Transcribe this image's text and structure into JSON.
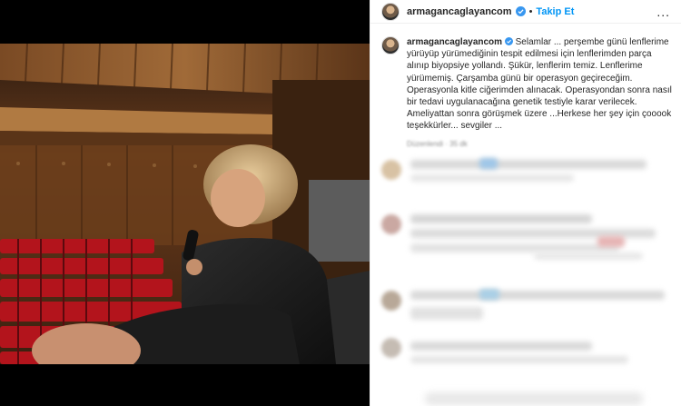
{
  "post": {
    "username": "armagancaglayancom",
    "follow_label": "Takip Et",
    "dot": "•",
    "more_label": "...",
    "caption": {
      "username": "armagancaglayancom",
      "text": "Selamlar ... perşembe günü lenflerime yürüyüp yürümediğinin tespit edilmesi için lenflerimden parça alınıp biyopsiye yollandı. Şükür, lenflerim temiz. Lenflerime yürümemiş. Çarşamba günü bir operasyon geçireceğim. Operasyonla kitle ciğerimden alınacak. Operasyondan sonra nasıl bir tedavi uygulanacağına genetik testiyle karar verilecek. Ameliyattan sonra görüşmek üzere ...Herkese her şey için çooook teşekkürler... sevgiler ...",
      "meta": "Düzenlendi · 35 dk"
    }
  },
  "colors": {
    "accent": "#0095f6",
    "verified": "#3897f0",
    "theater_wood": "#8a4e22",
    "seats": "#b3141c"
  },
  "icons": {
    "verified": "verified-badge-icon",
    "more": "more-options-icon"
  }
}
